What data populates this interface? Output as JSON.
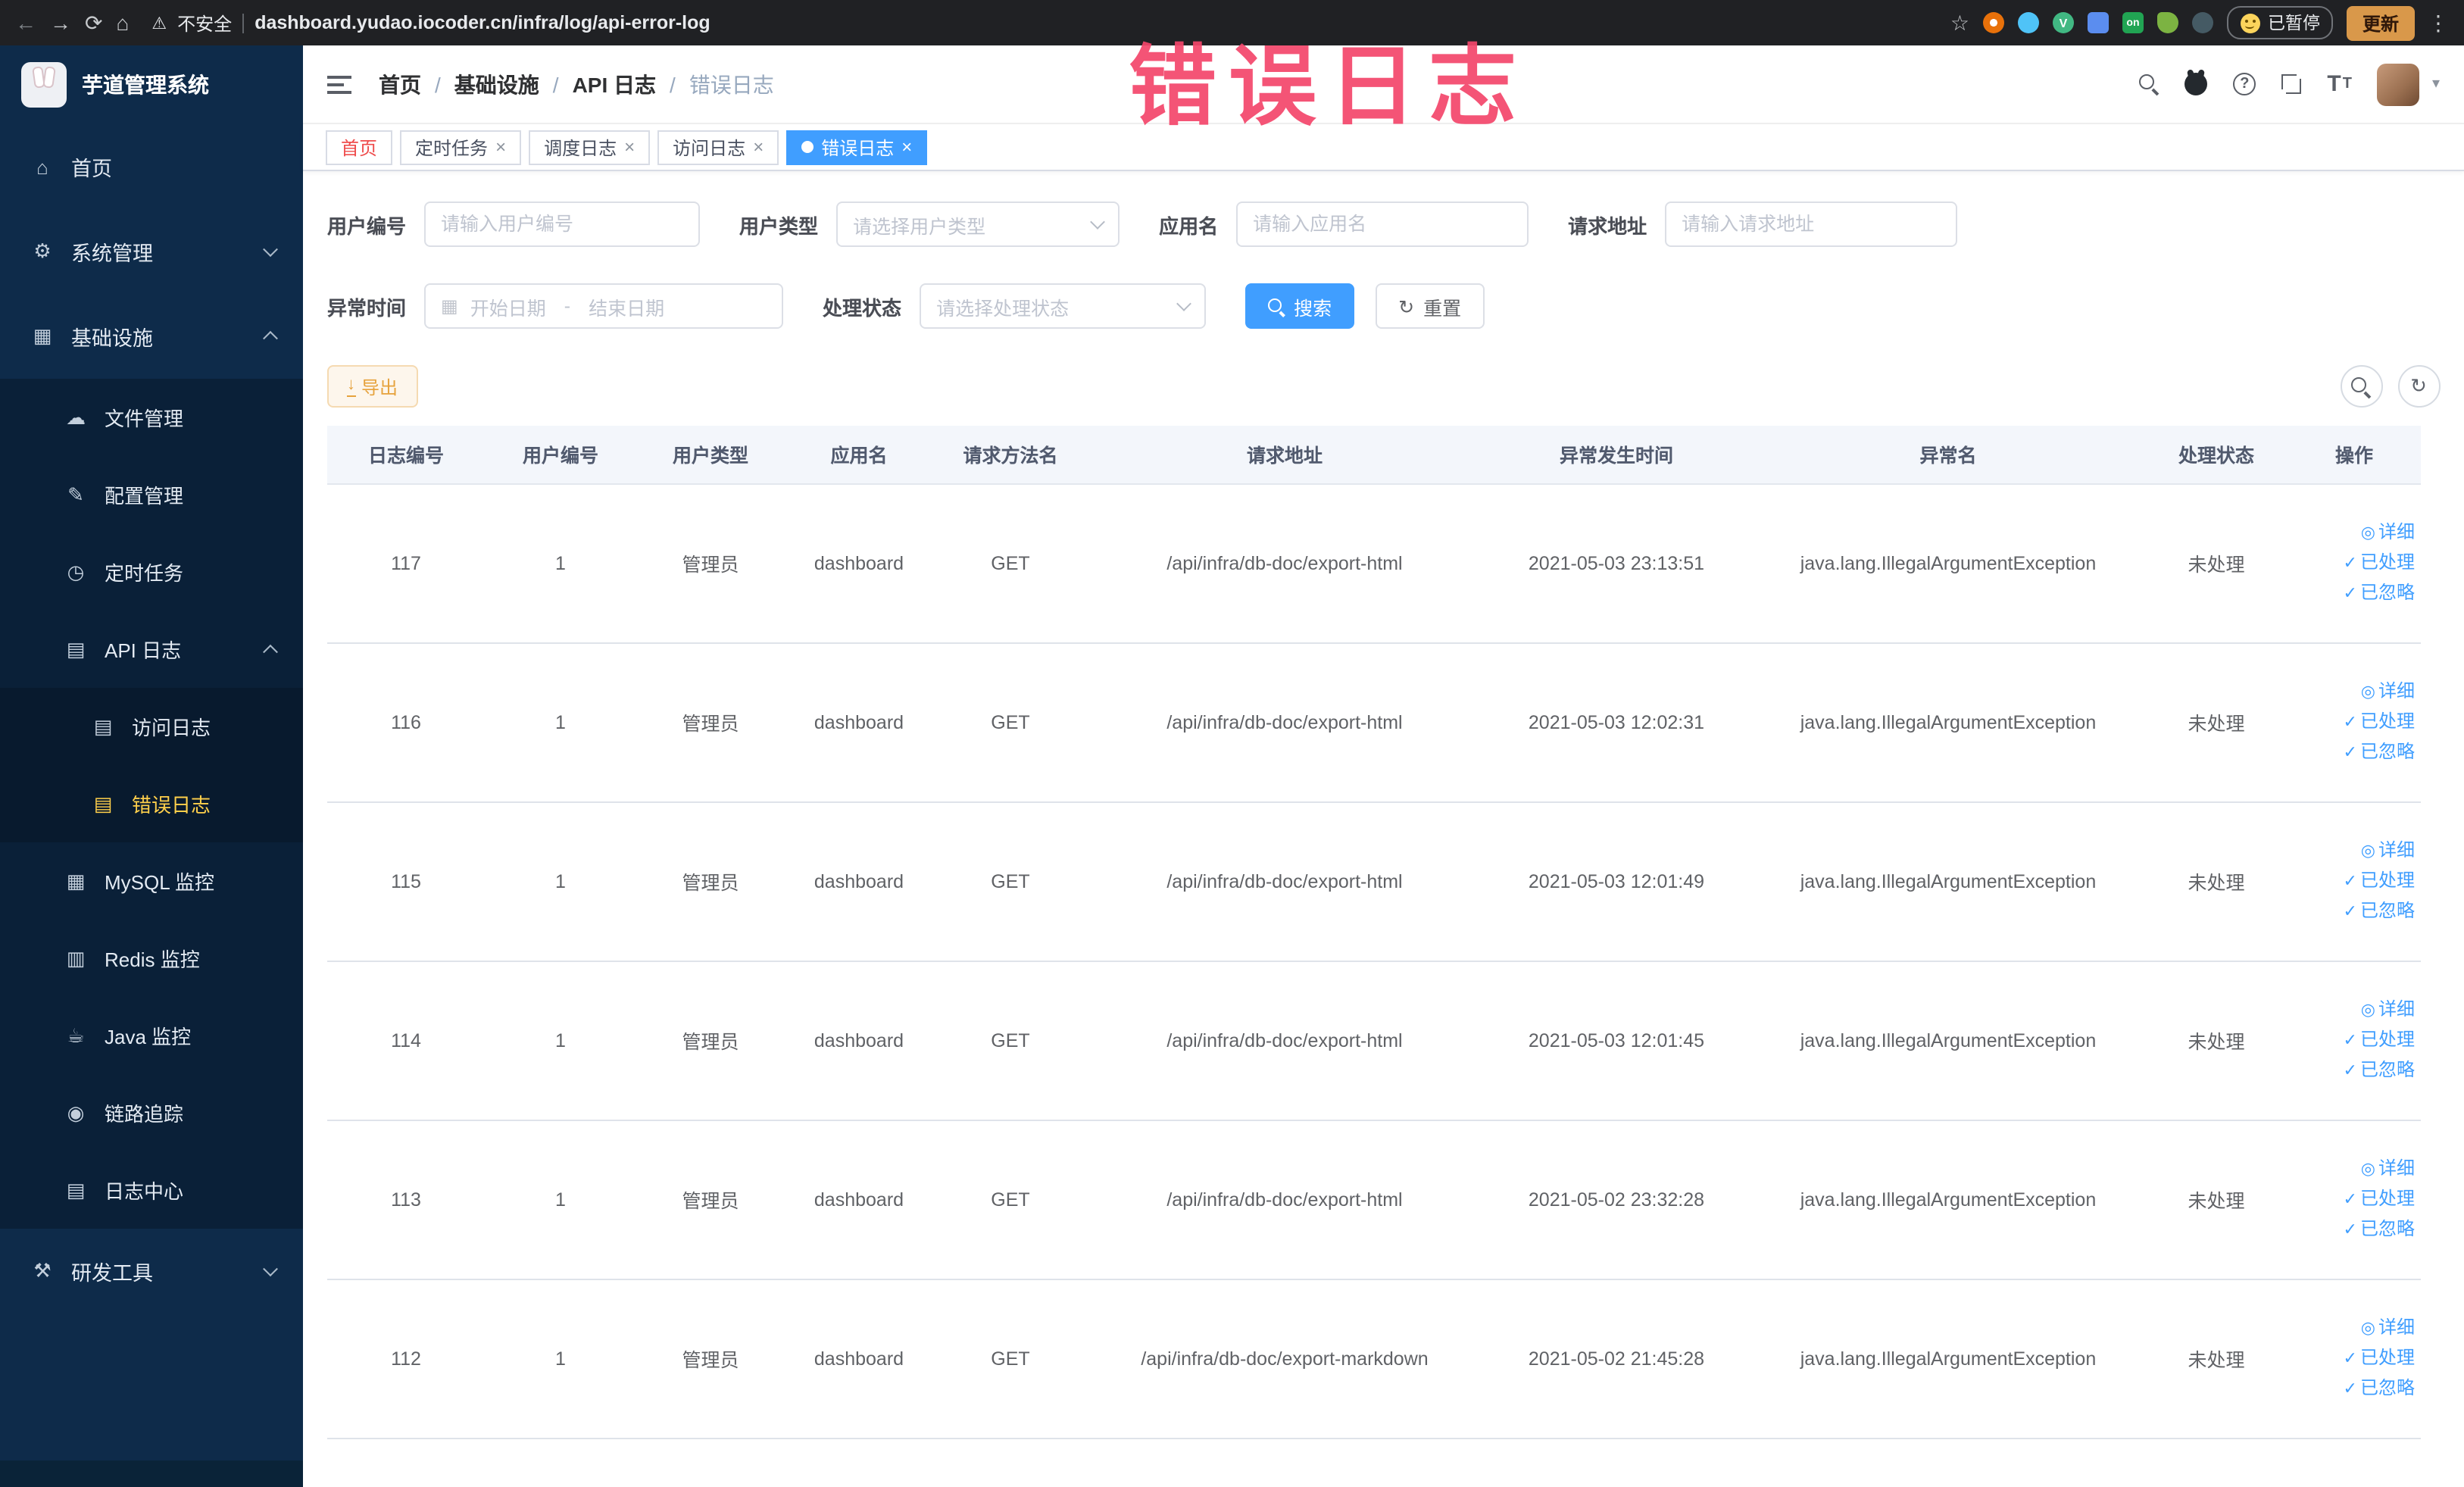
{
  "annotation": {
    "text": "错误日志"
  },
  "browser": {
    "not_secure": "不安全",
    "url": "dashboard.yudao.iocoder.cn/infra/log/api-error-log",
    "ext_v": "V",
    "ext_on": "on",
    "paused": "已暂停",
    "update": "更新"
  },
  "icons": {
    "back": "←",
    "forward": "→",
    "reload": "⟳",
    "home": "⌂",
    "warning": "⚠",
    "star": "☆",
    "kebab": "⋮",
    "caret_down": "▾",
    "question": "?",
    "font_large": "T",
    "font_small": "T",
    "menu_home": "⌂",
    "menu_system": "⚙",
    "menu_infra": "▦",
    "menu_file": "☁",
    "menu_config": "✎",
    "menu_job": "◷",
    "menu_api_log": "▤",
    "menu_access_log": "▤",
    "menu_error_log": "▤",
    "menu_mysql": "▦",
    "menu_redis": "▥",
    "menu_java": "☕",
    "menu_trace": "◉",
    "menu_log_center": "▤",
    "menu_dev": "⚒",
    "calendar": "▦",
    "refresh": "↻",
    "download": "↓",
    "eye": "◎",
    "check": "✓",
    "close": "×"
  },
  "sidebar": {
    "title": "芋道管理系统",
    "home": "首页",
    "system": "系统管理",
    "infra": "基础设施",
    "file": "文件管理",
    "config": "配置管理",
    "job": "定时任务",
    "api_log": "API 日志",
    "access_log": "访问日志",
    "error_log": "错误日志",
    "mysql": "MySQL 监控",
    "redis": "Redis 监控",
    "java": "Java 监控",
    "trace": "链路追踪",
    "log_center": "日志中心",
    "dev": "研发工具"
  },
  "breadcrumb": {
    "separator": "/",
    "items": [
      "首页",
      "基础设施",
      "API 日志",
      "错误日志"
    ]
  },
  "tabs": {
    "home": "首页",
    "job": "定时任务",
    "schedule_log": "调度日志",
    "access_log": "访问日志",
    "error_log": "错误日志"
  },
  "filters": {
    "user_id_label": "用户编号",
    "user_id_placeholder": "请输入用户编号",
    "user_type_label": "用户类型",
    "user_type_placeholder": "请选择用户类型",
    "app_label": "应用名",
    "app_placeholder": "请输入应用名",
    "url_label": "请求地址",
    "url_placeholder": "请输入请求地址",
    "time_label": "异常时间",
    "start_placeholder": "开始日期",
    "range_separator": "-",
    "end_placeholder": "结束日期",
    "status_label": "处理状态",
    "status_placeholder": "请选择处理状态",
    "search": "搜索",
    "reset": "重置"
  },
  "toolbar": {
    "export": "导出"
  },
  "table": {
    "columns": [
      "日志编号",
      "用户编号",
      "用户类型",
      "应用名",
      "请求方法名",
      "请求地址",
      "异常发生时间",
      "异常名",
      "处理状态",
      "操作"
    ],
    "action_detail": "详细",
    "action_processed": "已处理",
    "action_ignored": "已忽略",
    "rows": [
      {
        "id": "117",
        "user_id": "1",
        "user_type": "管理员",
        "app": "dashboard",
        "method": "GET",
        "url": "/api/infra/db-doc/export-html",
        "time": "2021-05-03 23:13:51",
        "exception": "java.lang.IllegalArgumentException",
        "status": "未处理"
      },
      {
        "id": "116",
        "user_id": "1",
        "user_type": "管理员",
        "app": "dashboard",
        "method": "GET",
        "url": "/api/infra/db-doc/export-html",
        "time": "2021-05-03 12:02:31",
        "exception": "java.lang.IllegalArgumentException",
        "status": "未处理"
      },
      {
        "id": "115",
        "user_id": "1",
        "user_type": "管理员",
        "app": "dashboard",
        "method": "GET",
        "url": "/api/infra/db-doc/export-html",
        "time": "2021-05-03 12:01:49",
        "exception": "java.lang.IllegalArgumentException",
        "status": "未处理"
      },
      {
        "id": "114",
        "user_id": "1",
        "user_type": "管理员",
        "app": "dashboard",
        "method": "GET",
        "url": "/api/infra/db-doc/export-html",
        "time": "2021-05-03 12:01:45",
        "exception": "java.lang.IllegalArgumentException",
        "status": "未处理"
      },
      {
        "id": "113",
        "user_id": "1",
        "user_type": "管理员",
        "app": "dashboard",
        "method": "GET",
        "url": "/api/infra/db-doc/export-html",
        "time": "2021-05-02 23:32:28",
        "exception": "java.lang.IllegalArgumentException",
        "status": "未处理"
      },
      {
        "id": "112",
        "user_id": "1",
        "user_type": "管理员",
        "app": "dashboard",
        "method": "GET",
        "url": "/api/infra/db-doc/export-markdown",
        "time": "2021-05-02 21:45:28",
        "exception": "java.lang.IllegalArgumentException",
        "status": "未处理"
      }
    ]
  },
  "colors": {
    "accent": "#409eff",
    "menu_active": "#ffd04b",
    "annotation": "#f4466b",
    "warning_btn": "#e6a23c"
  }
}
